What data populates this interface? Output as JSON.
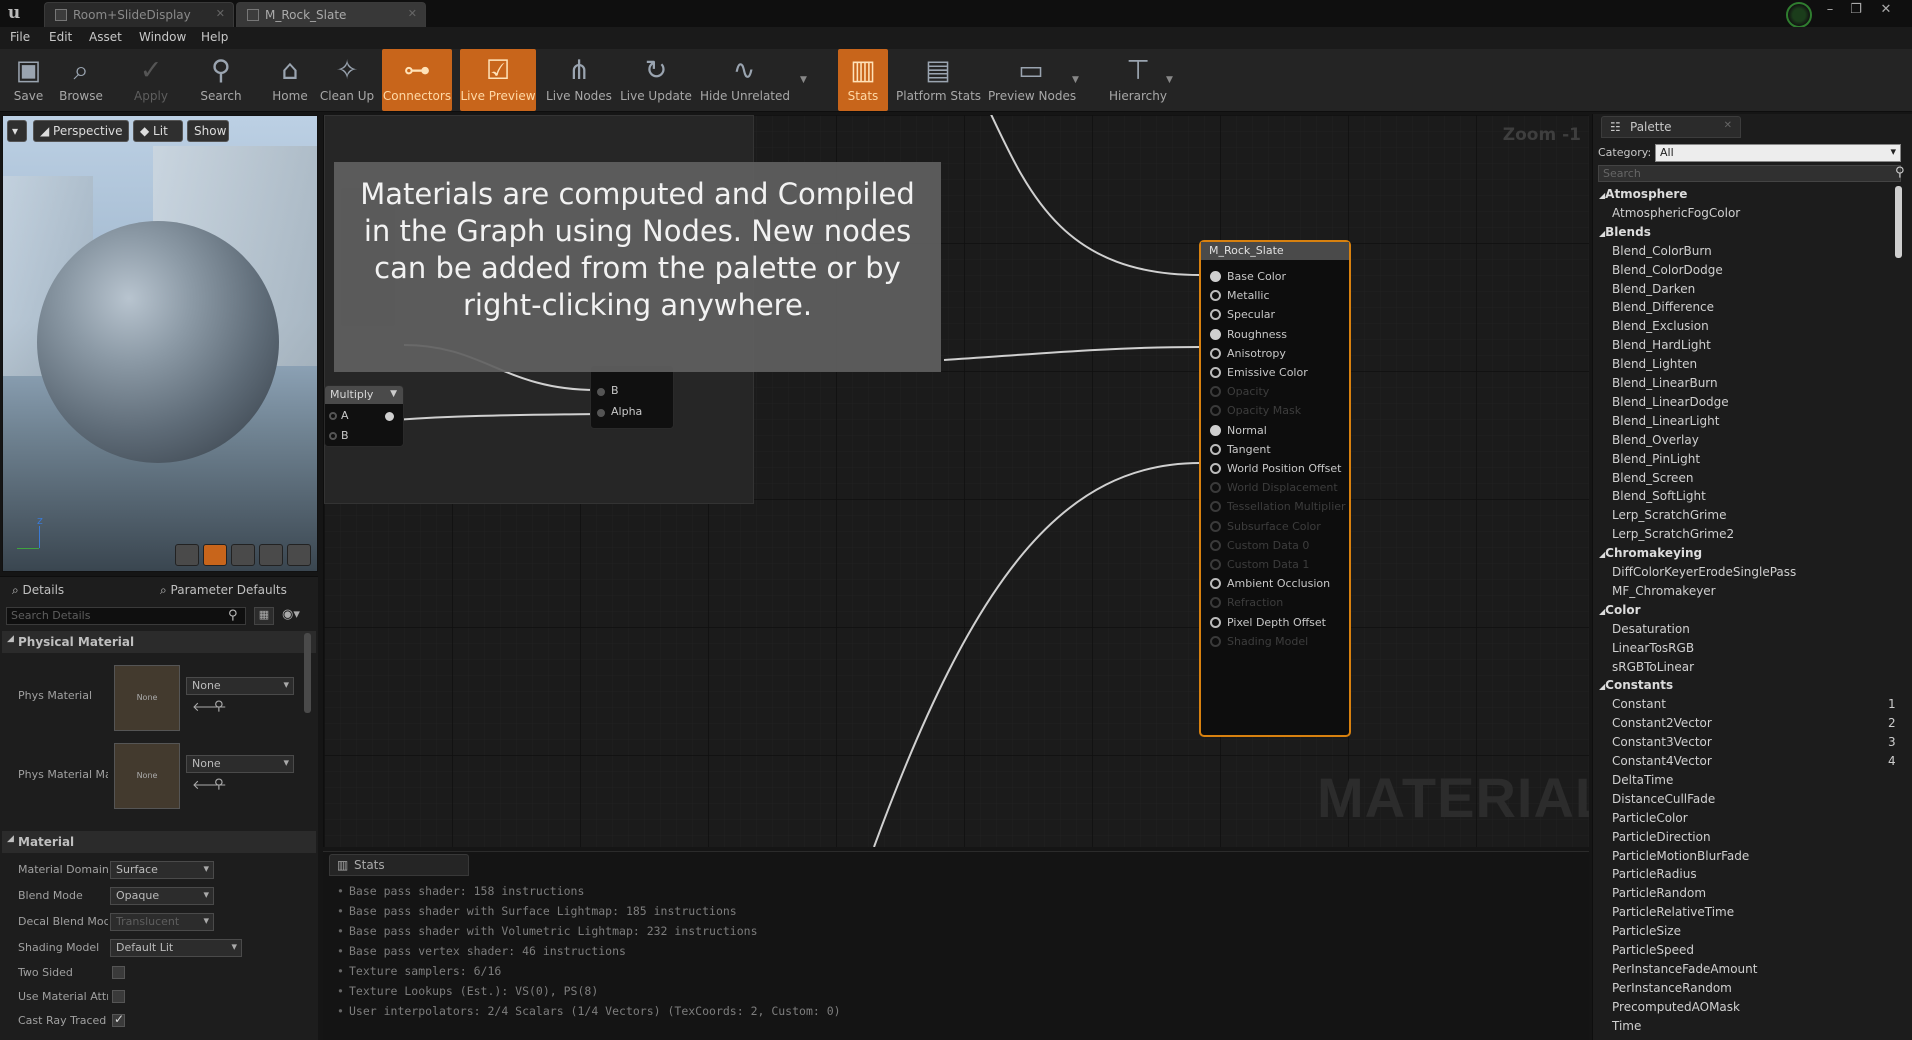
{
  "tabs": [
    {
      "label": "Room+SlideDisplay"
    },
    {
      "label": "M_Rock_Slate"
    }
  ],
  "menu": [
    "File",
    "Edit",
    "Asset",
    "Window",
    "Help"
  ],
  "toolbar": {
    "buttons": [
      {
        "label": "Save",
        "icon": "save-icon",
        "state": "normal"
      },
      {
        "label": "Browse",
        "icon": "browse-icon",
        "state": "normal"
      },
      {
        "label": "Apply",
        "icon": "apply-icon",
        "state": "disabled"
      },
      {
        "label": "Search",
        "icon": "search-icon",
        "state": "normal"
      },
      {
        "label": "Home",
        "icon": "home-icon",
        "state": "normal"
      },
      {
        "label": "Clean Up",
        "icon": "clean-up-icon",
        "state": "normal"
      },
      {
        "label": "Connectors",
        "icon": "connectors-icon",
        "state": "active"
      },
      {
        "label": "Live Preview",
        "icon": "live-preview-icon",
        "state": "active"
      },
      {
        "label": "Live Nodes",
        "icon": "live-nodes-icon",
        "state": "normal"
      },
      {
        "label": "Live Update",
        "icon": "live-update-icon",
        "state": "normal"
      },
      {
        "label": "Hide Unrelated",
        "icon": "hide-unrelated-icon",
        "state": "normal"
      },
      {
        "label": "Stats",
        "icon": "stats-icon",
        "state": "active"
      },
      {
        "label": "Platform Stats",
        "icon": "platform-stats-icon",
        "state": "normal"
      },
      {
        "label": "Preview Nodes",
        "icon": "preview-nodes-icon",
        "state": "normal"
      },
      {
        "label": "Hierarchy",
        "icon": "hierarchy-icon",
        "state": "normal"
      }
    ]
  },
  "viewport": {
    "perspective": "Perspective",
    "lit": "Lit",
    "show": "Show"
  },
  "details": {
    "tab_details": "Details",
    "tab_params": "Parameter Defaults",
    "search_placeholder": "Search Details",
    "sec_physical": "Physical Material",
    "phys_material_label": "Phys Material",
    "phys_material_mask_label": "Phys Material Mask",
    "thumb_none": "None",
    "combo_none": "None",
    "sec_material": "Material",
    "rows": [
      {
        "label": "Material Domain",
        "value": "Surface",
        "enabled": true
      },
      {
        "label": "Blend Mode",
        "value": "Opaque",
        "enabled": true
      },
      {
        "label": "Decal Blend Mode",
        "value": "Translucent",
        "enabled": false
      },
      {
        "label": "Shading Model",
        "value": "Default Lit",
        "enabled": true
      }
    ],
    "checks": [
      {
        "label": "Two Sided",
        "checked": false
      },
      {
        "label": "Use Material Attributes",
        "checked": false
      },
      {
        "label": "Cast Ray Traced Shadows",
        "checked": true
      }
    ]
  },
  "graph": {
    "zoom": "Zoom -1",
    "watermark": "MATERIAL",
    "callout": "Materials are computed and Compiled in the Graph using Nodes. New nodes can be added from the palette or by right-clicking anywhere.",
    "multiply": {
      "title": "Multiply",
      "pin_a": "A",
      "pin_b": "B"
    },
    "lerp": {
      "pin_b": "B",
      "pin_alpha": "Alpha"
    },
    "material_node": {
      "title": "M_Rock_Slate",
      "pins": [
        {
          "label": "Base Color",
          "state": "filled"
        },
        {
          "label": "Metallic",
          "state": "empty"
        },
        {
          "label": "Specular",
          "state": "empty"
        },
        {
          "label": "Roughness",
          "state": "filled"
        },
        {
          "label": "Anisotropy",
          "state": "empty"
        },
        {
          "label": "Emissive Color",
          "state": "empty"
        },
        {
          "label": "Opacity",
          "state": "off"
        },
        {
          "label": "Opacity Mask",
          "state": "off"
        },
        {
          "label": "Normal",
          "state": "filled"
        },
        {
          "label": "Tangent",
          "state": "empty"
        },
        {
          "label": "World Position Offset",
          "state": "empty"
        },
        {
          "label": "World Displacement",
          "state": "off"
        },
        {
          "label": "Tessellation Multiplier",
          "state": "off"
        },
        {
          "label": "Subsurface Color",
          "state": "off"
        },
        {
          "label": "Custom Data 0",
          "state": "off"
        },
        {
          "label": "Custom Data 1",
          "state": "off"
        },
        {
          "label": "Ambient Occlusion",
          "state": "empty"
        },
        {
          "label": "Refraction",
          "state": "off"
        },
        {
          "label": "Pixel Depth Offset",
          "state": "empty"
        },
        {
          "label": "Shading Model",
          "state": "off"
        }
      ]
    }
  },
  "stats": {
    "tab": "Stats",
    "lines": [
      "Base pass shader: 158 instructions",
      "Base pass shader with Surface Lightmap: 185 instructions",
      "Base pass shader with Volumetric Lightmap: 232 instructions",
      "Base pass vertex shader: 46 instructions",
      "Texture samplers: 6/16",
      "Texture Lookups (Est.): VS(0), PS(8)",
      "User interpolators: 2/4 Scalars (1/4 Vectors) (TexCoords: 2, Custom: 0)"
    ]
  },
  "palette": {
    "tab": "Palette",
    "category_label": "Category:",
    "category_value": "All",
    "search_placeholder": "Search",
    "items": [
      {
        "label": "Atmosphere",
        "type": "cat"
      },
      {
        "label": "AtmosphericFogColor",
        "type": "item"
      },
      {
        "label": "Blends",
        "type": "cat"
      },
      {
        "label": "Blend_ColorBurn",
        "type": "item"
      },
      {
        "label": "Blend_ColorDodge",
        "type": "item"
      },
      {
        "label": "Blend_Darken",
        "type": "item"
      },
      {
        "label": "Blend_Difference",
        "type": "item"
      },
      {
        "label": "Blend_Exclusion",
        "type": "item"
      },
      {
        "label": "Blend_HardLight",
        "type": "item"
      },
      {
        "label": "Blend_Lighten",
        "type": "item"
      },
      {
        "label": "Blend_LinearBurn",
        "type": "item"
      },
      {
        "label": "Blend_LinearDodge",
        "type": "item"
      },
      {
        "label": "Blend_LinearLight",
        "type": "item"
      },
      {
        "label": "Blend_Overlay",
        "type": "item"
      },
      {
        "label": "Blend_PinLight",
        "type": "item"
      },
      {
        "label": "Blend_Screen",
        "type": "item"
      },
      {
        "label": "Blend_SoftLight",
        "type": "item"
      },
      {
        "label": "Lerp_ScratchGrime",
        "type": "item"
      },
      {
        "label": "Lerp_ScratchGrime2",
        "type": "item"
      },
      {
        "label": "Chromakeying",
        "type": "cat"
      },
      {
        "label": "DiffColorKeyerErodeSinglePass",
        "type": "item"
      },
      {
        "label": "MF_Chromakeyer",
        "type": "item"
      },
      {
        "label": "Color",
        "type": "cat"
      },
      {
        "label": "Desaturation",
        "type": "item"
      },
      {
        "label": "LinearTosRGB",
        "type": "item"
      },
      {
        "label": "sRGBToLinear",
        "type": "item"
      },
      {
        "label": "Constants",
        "type": "cat"
      },
      {
        "label": "Constant",
        "type": "item",
        "key": "1"
      },
      {
        "label": "Constant2Vector",
        "type": "item",
        "key": "2"
      },
      {
        "label": "Constant3Vector",
        "type": "item",
        "key": "3"
      },
      {
        "label": "Constant4Vector",
        "type": "item",
        "key": "4"
      },
      {
        "label": "DeltaTime",
        "type": "item"
      },
      {
        "label": "DistanceCullFade",
        "type": "item"
      },
      {
        "label": "ParticleColor",
        "type": "item"
      },
      {
        "label": "ParticleDirection",
        "type": "item"
      },
      {
        "label": "ParticleMotionBlurFade",
        "type": "item"
      },
      {
        "label": "ParticleRadius",
        "type": "item"
      },
      {
        "label": "ParticleRandom",
        "type": "item"
      },
      {
        "label": "ParticleRelativeTime",
        "type": "item"
      },
      {
        "label": "ParticleSize",
        "type": "item"
      },
      {
        "label": "ParticleSpeed",
        "type": "item"
      },
      {
        "label": "PerInstanceFadeAmount",
        "type": "item"
      },
      {
        "label": "PerInstanceRandom",
        "type": "item"
      },
      {
        "label": "PrecomputedAOMask",
        "type": "item"
      },
      {
        "label": "Time",
        "type": "item"
      }
    ]
  }
}
